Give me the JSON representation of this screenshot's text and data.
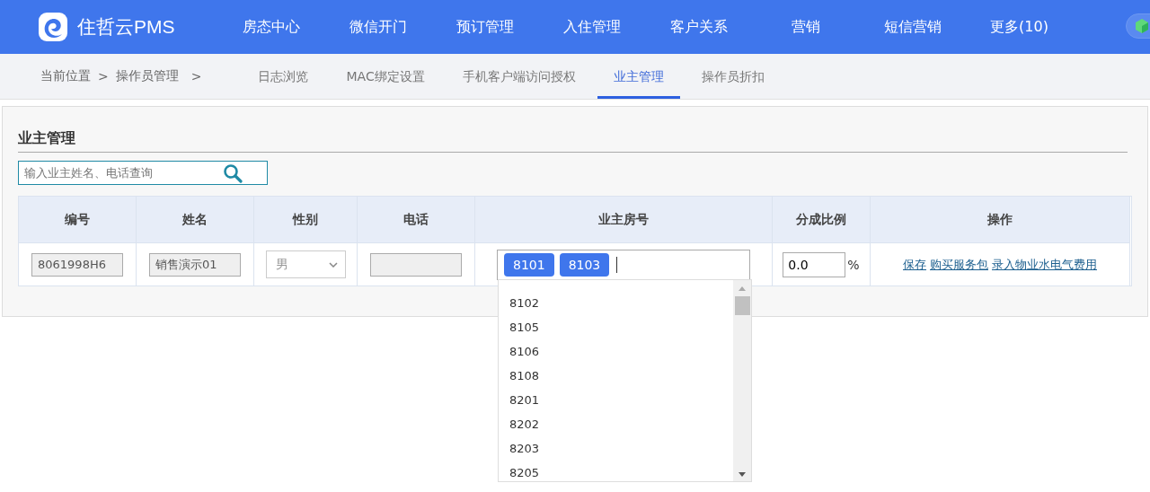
{
  "brand": "住哲云PMS",
  "nav": [
    {
      "label": "房态中心"
    },
    {
      "label": "微信开门"
    },
    {
      "label": "预订管理"
    },
    {
      "label": "入住管理"
    },
    {
      "label": "客户关系"
    },
    {
      "label": "营销"
    },
    {
      "label": "短信营销"
    },
    {
      "label": "更多(10)"
    }
  ],
  "breadcrumb": [
    "当前位置",
    ">",
    "操作员管理",
    ">"
  ],
  "tabs": [
    {
      "label": "日志浏览",
      "selected": false
    },
    {
      "label": "MAC绑定设置",
      "selected": false
    },
    {
      "label": "手机客户端访问授权",
      "selected": false
    },
    {
      "label": "业主管理",
      "selected": true
    },
    {
      "label": "操作员折扣",
      "selected": false
    }
  ],
  "section_title": "业主管理",
  "search": {
    "placeholder": "输入业主姓名、电话查询"
  },
  "table": {
    "columns": [
      "编号",
      "姓名",
      "性别",
      "电话",
      "业主房号",
      "分成比例",
      "操作"
    ],
    "rows": [
      {
        "id": "8061998H6",
        "name": "销售演示01",
        "gender": "男",
        "rooms": [
          "8101",
          "8103"
        ],
        "ratio": "0.0",
        "ratio_unit": "%",
        "actions": [
          "保存",
          "购买服务包",
          "录入物业水电气费用"
        ]
      }
    ]
  },
  "room_dropdown": [
    "8102",
    "8105",
    "8106",
    "8108",
    "8201",
    "8202",
    "8203",
    "8205"
  ]
}
